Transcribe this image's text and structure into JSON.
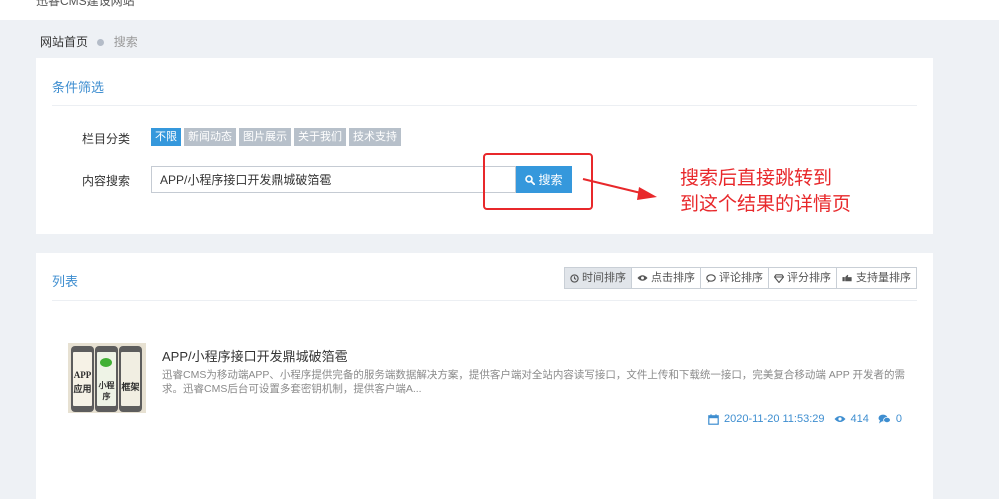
{
  "topbar": {
    "text": "迅睿CMS建设网站"
  },
  "breadcrumb": {
    "home": "网站首页",
    "current": "搜索"
  },
  "filter": {
    "title": "条件筛选",
    "category_label": "栏目分类",
    "categories": [
      {
        "label": "不限",
        "active": true
      },
      {
        "label": "新闻动态",
        "active": false
      },
      {
        "label": "图片展示",
        "active": false
      },
      {
        "label": "关于我们",
        "active": false
      },
      {
        "label": "技术支持",
        "active": false
      }
    ],
    "search_label": "内容搜索",
    "search_value": "APP/小程序接口开发鼎城破箔雹",
    "search_button": "搜索",
    "annotation_line1": "搜索后直接跳转到",
    "annotation_line2": "到这个结果的详情页"
  },
  "list": {
    "title": "列表",
    "sort_buttons": [
      {
        "label": "时间排序",
        "icon": "clock-icon",
        "active": true
      },
      {
        "label": "点击排序",
        "icon": "eye-icon",
        "active": false
      },
      {
        "label": "评论排序",
        "icon": "comment-icon",
        "active": false
      },
      {
        "label": "评分排序",
        "icon": "diamond-icon",
        "active": false
      },
      {
        "label": "支持量排序",
        "icon": "thumbs-up-icon",
        "active": false
      }
    ],
    "items": [
      {
        "title": "APP/小程序接口开发鼎城破箔雹",
        "description": "迅睿CMS为移动端APP、小程序提供完备的服务端数据解决方案，提供客户端对全站内容读写接口，文件上传和下载统一接口，完美复合移动端 APP 开发者的需求。迅睿CMS后台可设置多套密钥机制，提供客户端A...",
        "date": "2020-11-20 11:53:29",
        "views": "414",
        "comments": "0",
        "thumbnail_labels": [
          "APP",
          "应用",
          "小程序",
          "框架"
        ]
      }
    ]
  },
  "colors": {
    "accent": "#3598dc",
    "annotation": "#e8282b",
    "link": "#3e8ed0",
    "background": "#eef1f5"
  }
}
